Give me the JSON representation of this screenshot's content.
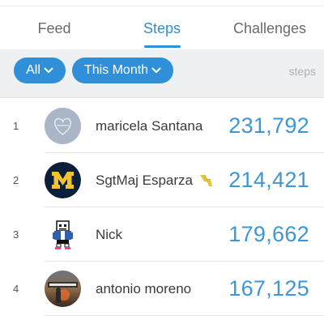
{
  "tabs": [
    {
      "label": "Feed"
    },
    {
      "label": "Steps"
    },
    {
      "label": "Challenges"
    }
  ],
  "filters": {
    "scope": "All",
    "period": "This Month",
    "metric_hint": "steps"
  },
  "colors": {
    "accent": "#2f8fd8",
    "value": "#3d96d6",
    "filter_bg": "#eef0f2"
  },
  "leaderboard": [
    {
      "rank": "1",
      "name": "maricela Santana",
      "steps": "231,792",
      "avatar": "heart-avatar"
    },
    {
      "rank": "2",
      "name": "SgtMaj Esparza",
      "steps": "214,421",
      "avatar": "michigan-m-avatar",
      "badge": "lightning-badge-icon"
    },
    {
      "rank": "3",
      "name": "Nick",
      "steps": "179,662",
      "avatar": "pixel-skeleton-avatar"
    },
    {
      "rank": "4",
      "name": "antonio moreno",
      "steps": "167,125",
      "avatar": "game-cover-avatar"
    }
  ]
}
